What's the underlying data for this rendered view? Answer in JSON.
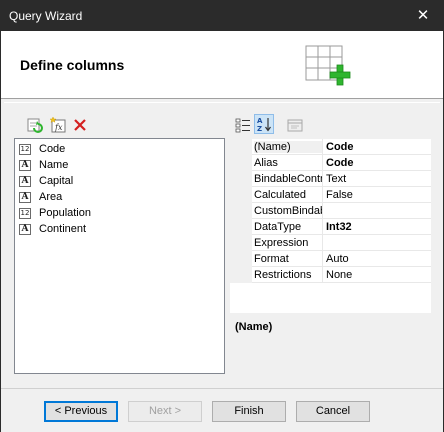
{
  "window": {
    "title": "Query Wizard",
    "close_glyph": "✕"
  },
  "header": {
    "heading": "Define columns",
    "icon": "table-add-icon"
  },
  "left_toolbar": {
    "icons": [
      "refresh-icon",
      "new-expression-icon",
      "delete-icon"
    ]
  },
  "columns": [
    {
      "type": "12",
      "type_kind": "numeric",
      "name": "Code"
    },
    {
      "type": "A",
      "type_kind": "text",
      "name": "Name"
    },
    {
      "type": "A",
      "type_kind": "text",
      "name": "Capital"
    },
    {
      "type": "A",
      "type_kind": "text",
      "name": "Area"
    },
    {
      "type": "12",
      "type_kind": "numeric",
      "name": "Population"
    },
    {
      "type": "A",
      "type_kind": "text",
      "name": "Continent"
    }
  ],
  "property_toolbar": {
    "icons": [
      "categorized-icon",
      "alphabetical-icon",
      "property-pages-icon"
    ],
    "active": "alphabetical-icon"
  },
  "properties": [
    {
      "name": "(Name)",
      "value": "Code",
      "bold": true
    },
    {
      "name": "Alias",
      "value": "Code",
      "bold": true
    },
    {
      "name": "BindableContr",
      "value": "Text",
      "bold": false
    },
    {
      "name": "Calculated",
      "value": "False",
      "bold": false
    },
    {
      "name": "CustomBindab",
      "value": "",
      "bold": false
    },
    {
      "name": "DataType",
      "value": "Int32",
      "bold": true
    },
    {
      "name": "Expression",
      "value": "",
      "bold": false
    },
    {
      "name": "Format",
      "value": "Auto",
      "bold": false
    },
    {
      "name": "Restrictions",
      "value": "None",
      "bold": false
    }
  ],
  "description": {
    "title": "(Name)"
  },
  "buttons": {
    "previous": "< Previous",
    "next": "Next >",
    "finish": "Finish",
    "cancel": "Cancel"
  },
  "colors": {
    "titlebar": "#2b2b2b",
    "accent": "#0078d7",
    "delete": "#d42020",
    "add": "#2fb52f"
  }
}
